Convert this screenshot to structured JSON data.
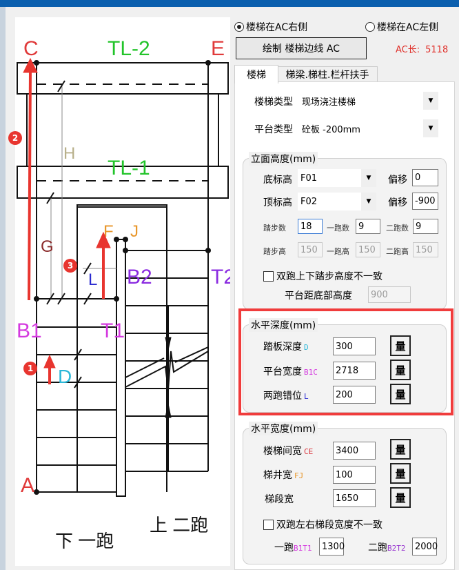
{
  "side": {
    "options": [
      {
        "label": "楼梯在AC右侧",
        "selected": true
      },
      {
        "label": "楼梯在AC左侧",
        "selected": false
      }
    ]
  },
  "draw_button": "绘制 楼梯边线 AC",
  "ac_length": {
    "label": "AC长:",
    "value": "5118",
    "color": "#e0302a"
  },
  "tabs": [
    {
      "label": "楼梯",
      "active": true
    },
    {
      "label": "梯梁.梯柱.栏杆扶手",
      "active": false
    }
  ],
  "stair_type": {
    "label": "楼梯类型",
    "value": "现场浇注楼梯"
  },
  "platform_type": {
    "label": "平台类型",
    "value": "砼板 -200mm"
  },
  "elevation": {
    "title": "立面高度(mm)",
    "bottom": {
      "label": "底标高",
      "value": "F01",
      "offset_label": "偏移",
      "offset": "0"
    },
    "top": {
      "label": "顶标高",
      "value": "F02",
      "offset_label": "偏移",
      "offset": "-900"
    },
    "steps": {
      "label": "踏步数",
      "value": "18",
      "run1_label": "一跑数",
      "run1": "9",
      "run2_label": "二跑数",
      "run2": "9"
    },
    "heights": {
      "label": "踏步高",
      "value": "150",
      "run1_label": "一跑高",
      "run1": "150",
      "run2_label": "二跑高",
      "run2": "150"
    },
    "inconsistent_label": "双跑上下踏步高度不一致",
    "platform_height_label": "平台距底部高度",
    "platform_height": "900"
  },
  "depth": {
    "title": "水平深度(mm)",
    "rows": [
      {
        "label": "踏板深度",
        "code": "D",
        "code_color": "#2bb7d8",
        "value": "300",
        "button": "量"
      },
      {
        "label": "平台宽度",
        "code": "B1C",
        "code_color": "#d43adf",
        "value": "2718",
        "button": "量"
      },
      {
        "label": "两跑错位",
        "code": "L",
        "code_color": "#2b2bd0",
        "value": "200",
        "button": "量"
      }
    ]
  },
  "width": {
    "title": "水平宽度(mm)",
    "rows": [
      {
        "label": "楼梯间宽",
        "code": "CE",
        "code_color": "#d8323a",
        "value": "3400",
        "button": "量"
      },
      {
        "label": "梯井宽",
        "code": "FJ",
        "code_color": "#e8962a",
        "value": "100",
        "button": "量"
      },
      {
        "label": "梯段宽",
        "code": "",
        "code_color": "#000000",
        "value": "1650",
        "button": "量"
      }
    ],
    "inconsistent_label": "双跑左右梯段宽度不一致",
    "run1": {
      "label": "一跑",
      "code": "B1T1",
      "value": "1300"
    },
    "run2": {
      "label": "二跑",
      "code": "B2T2",
      "value": "2000"
    }
  },
  "diagram": {
    "labels": {
      "C": "C",
      "E": "E",
      "TL2": "TL-2",
      "TL1": "TL-1",
      "H": "H",
      "G": "G",
      "F": "F",
      "J": "J",
      "L": "L",
      "B2": "B2",
      "T2": "T2",
      "B1": "B1",
      "T1": "T1",
      "D": "D",
      "A": "A",
      "down": "下 一跑",
      "up": "上 二跑"
    },
    "badges": [
      "1",
      "2",
      "3"
    ]
  }
}
